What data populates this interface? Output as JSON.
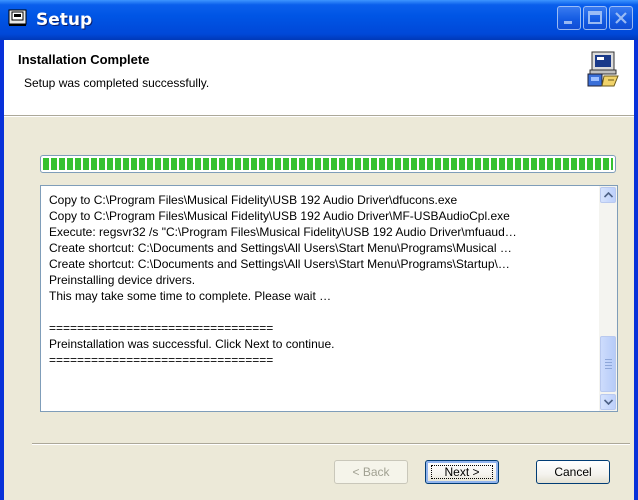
{
  "window": {
    "title": "Setup"
  },
  "header": {
    "title": "Installation Complete",
    "subtitle": "Setup was completed successfully."
  },
  "progress": {
    "fraction": 1.0,
    "color": "#35c130"
  },
  "log": {
    "lines": [
      "Copy to C:\\Program Files\\Musical Fidelity\\USB 192 Audio Driver\\dfucons.exe",
      "Copy to C:\\Program Files\\Musical Fidelity\\USB 192 Audio Driver\\MF-USBAudioCpl.exe",
      "Execute: regsvr32 /s \"C:\\Program Files\\Musical Fidelity\\USB 192 Audio Driver\\mfuaud…",
      "Create shortcut: C:\\Documents and Settings\\All Users\\Start Menu\\Programs\\Musical …",
      "Create shortcut: C:\\Documents and Settings\\All Users\\Start Menu\\Programs\\Startup\\…",
      "Preinstalling device drivers.",
      "This may take some time to complete. Please wait …",
      "",
      "================================",
      "Preinstallation was successful. Click Next to continue.",
      "================================"
    ]
  },
  "buttons": {
    "back": "< Back",
    "next": "Next >",
    "cancel": "Cancel"
  },
  "icons": {
    "title": "setup-app-icon",
    "header": "installer-computer-icon",
    "minimize": "minimize-icon",
    "maximize": "maximize-icon",
    "close": "close-icon",
    "scroll_up": "arrow-up-icon",
    "scroll_down": "arrow-down-icon"
  },
  "colors": {
    "titlebar": "#0055e5",
    "face": "#ece9d8",
    "progress": "#35c130"
  }
}
